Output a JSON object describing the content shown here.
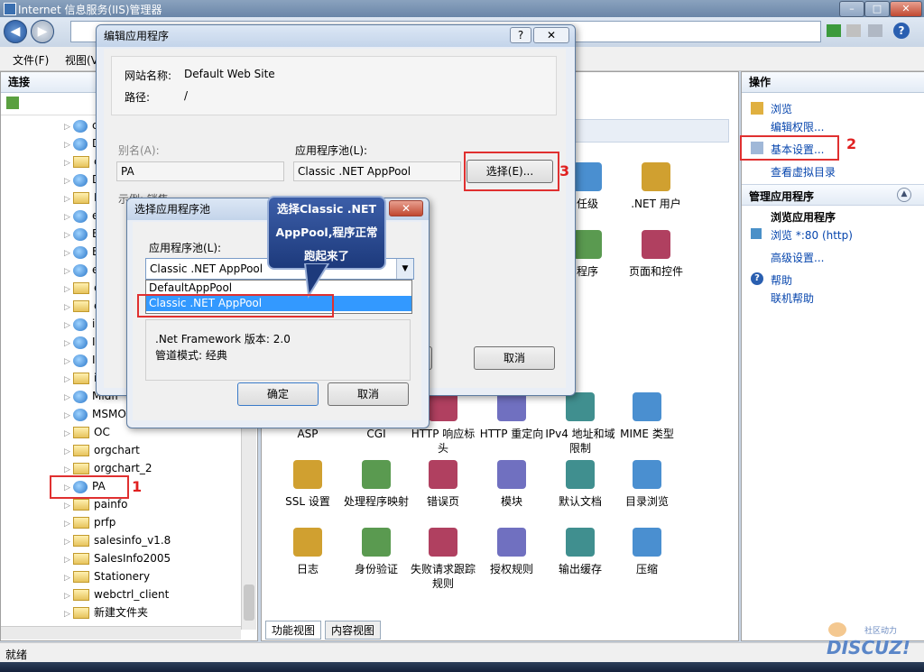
{
  "window": {
    "title": "Internet 信息服务(IIS)管理器"
  },
  "menu": [
    "文件(F)",
    "视图(V"
  ],
  "left_panel": {
    "header": "连接",
    "tree": [
      "c",
      "D",
      "c",
      "D",
      "E",
      "e",
      "E",
      "E",
      "e",
      "e",
      "e",
      "i",
      "I",
      "I",
      "i",
      "Midfr",
      "MSMO",
      "OC",
      "orgchart",
      "orgchart_2",
      "PA",
      "painfo",
      "prfp",
      "salesinfo_v1.8",
      "SalesInfo2005",
      "Stationery",
      "webctrl_client",
      "新建文件夹"
    ]
  },
  "center": {
    "features_row1": [
      "任级",
      ".NET 用户",
      "程序",
      "页面和控件"
    ],
    "features_row2": [
      "ASP",
      "CGI",
      "HTTP 响应标头",
      "HTTP 重定向",
      "IPv4 地址和域限制",
      "MIME 类型"
    ],
    "features_row3": [
      "SSL 设置",
      "处理程序映射",
      "错误页",
      "模块",
      "默认文档",
      "目录浏览"
    ],
    "features_row4": [
      "日志",
      "身份验证",
      "失败请求跟踪规则",
      "授权规则",
      "输出缓存",
      "压缩"
    ],
    "tabs": [
      "功能视图",
      "内容视图"
    ]
  },
  "right_panel": {
    "header": "操作",
    "actions": [
      "浏览",
      "编辑权限...",
      "基本设置...",
      "查看虚拟目录"
    ],
    "section2": "管理应用程序",
    "sub_head": "浏览应用程序",
    "actions2": [
      "浏览 *:80 (http)",
      "高级设置..."
    ],
    "help": [
      "帮助",
      "联机帮助"
    ]
  },
  "status": {
    "text": "就绪"
  },
  "edit_dialog": {
    "title": "编辑应用程序",
    "site_label": "网站名称:",
    "site_value": "Default Web Site",
    "path_label": "路径:",
    "path_value": "/",
    "alias_label": "别名(A):",
    "alias_value": "PA",
    "pool_label": "应用程序池(L):",
    "pool_value": "Classic .NET AppPool",
    "select_button": "选择(E)...",
    "example_label": "示例: 销售",
    "cancel": "取消"
  },
  "select_dialog": {
    "title": "选择应用程序池",
    "pool_label": "应用程序池(L):",
    "selected": "Classic .NET AppPool",
    "options": [
      "DefaultAppPool",
      "Classic .NET AppPool"
    ],
    "framework": ".Net Framework 版本: 2.0",
    "pipeline": "管道模式: 经典",
    "ok": "确定",
    "cancel": "取消"
  },
  "callout": {
    "line1": "选择Classic .NET",
    "line2": "AppPool,程序正常",
    "line3": "跑起来了"
  },
  "annotations": [
    "1",
    "2",
    "3"
  ],
  "watermark": {
    "top": "社区动力",
    "bottom": "DISCUZ!"
  }
}
